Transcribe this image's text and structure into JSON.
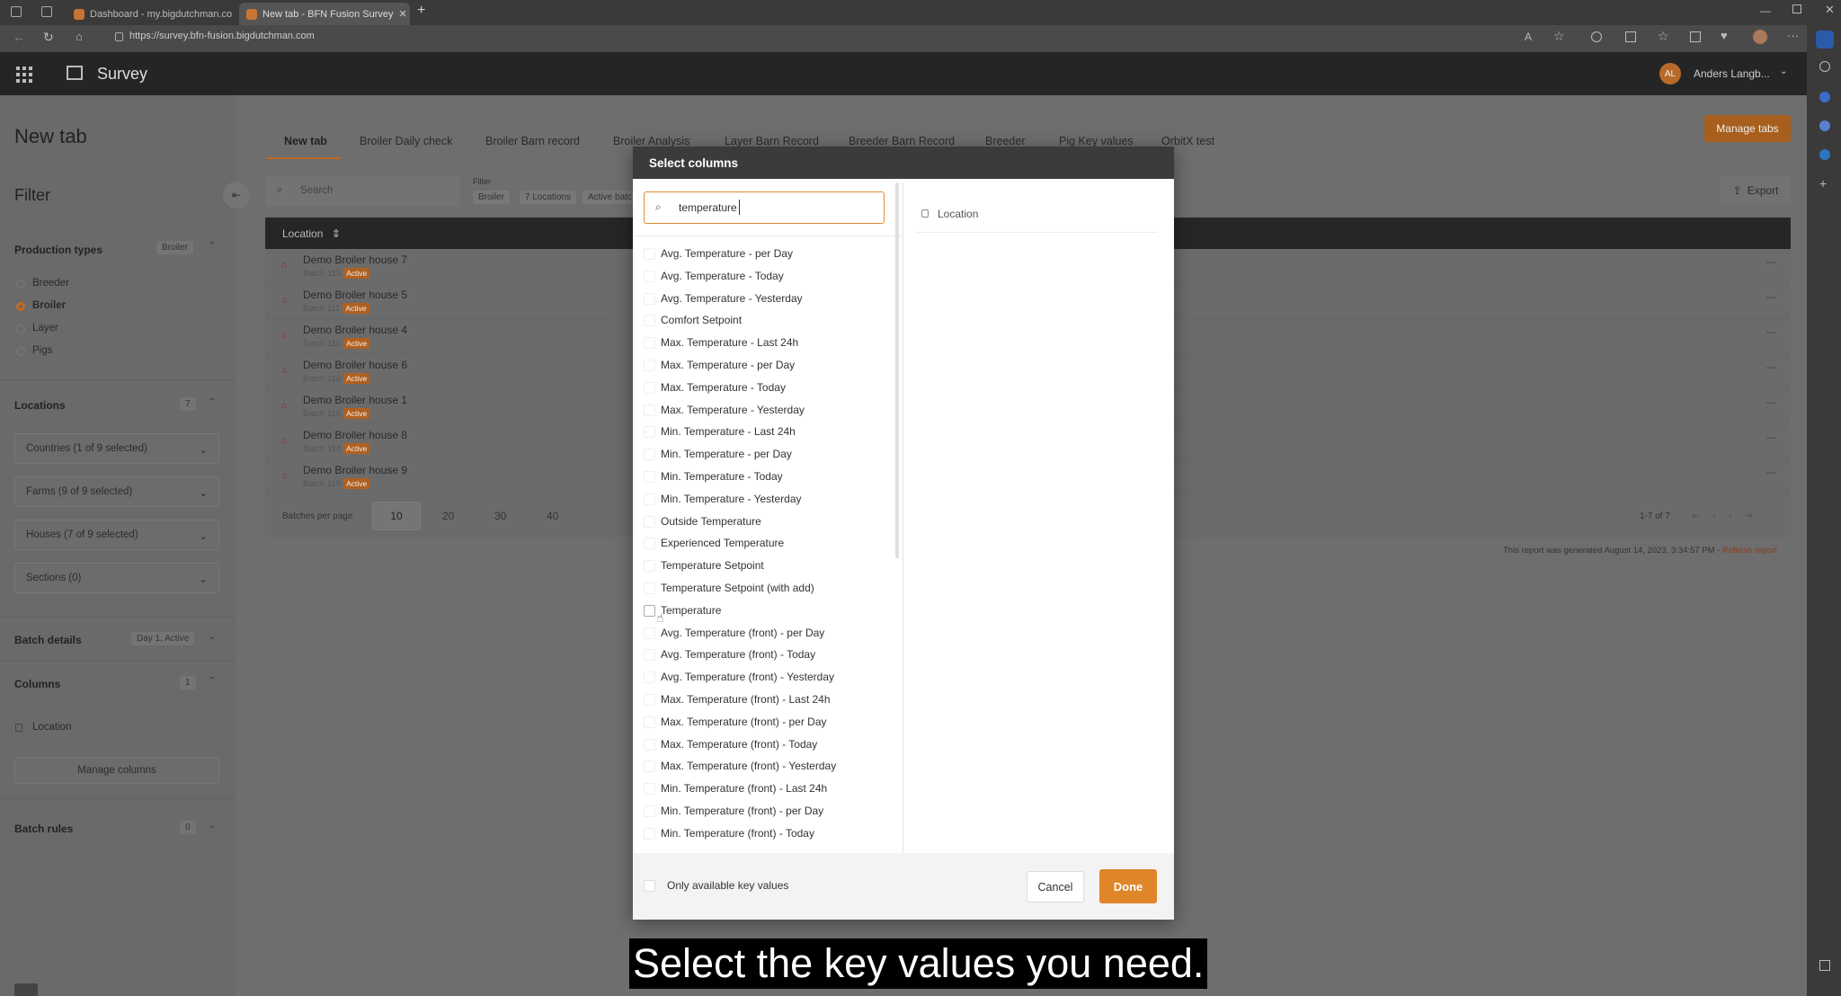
{
  "browser": {
    "tabs": [
      {
        "label": "Dashboard - my.bigdutchman.co",
        "active": false
      },
      {
        "label": "New tab - BFN Fusion Survey",
        "active": true
      }
    ],
    "new_tab_symbol": "+",
    "url": "https://survey.bfn-fusion.bigdutchman.com"
  },
  "appbar": {
    "title": "Survey",
    "user_initials": "AL",
    "user_name": "Anders Langb..."
  },
  "page": {
    "title": "New tab",
    "manage_tabs_label": "Manage tabs",
    "tabs": [
      "New tab",
      "Broiler Daily check",
      "Broiler Barn record",
      "Broiler Analysis",
      "Layer Barn Record",
      "Breeder Barn Record",
      "Breeder",
      "Pig Key values",
      "OrbitX test"
    ],
    "search_placeholder": "Search",
    "filter_label": "Filter",
    "filter_chips": [
      "Broiler",
      "7 Locations",
      "Active batc"
    ],
    "export_label": "Export",
    "report_note": "This report was generated August 14, 2023, 3:34:57 PM -",
    "refresh_label": "Refresh report"
  },
  "filter": {
    "title": "Filter",
    "production_types_label": "Production types",
    "production_types_badge": "Broiler",
    "production_options": [
      "Breeder",
      "Broiler",
      "Layer",
      "Pigs"
    ],
    "selected_production": "Broiler",
    "locations_label": "Locations",
    "locations_count": "7",
    "countries": "Countries (1 of 9 selected)",
    "farms": "Farms (9 of 9 selected)",
    "houses": "Houses (7 of 9 selected)",
    "sections": "Sections (0)",
    "batch_details_label": "Batch details",
    "batch_details_value": "Day 1, Active",
    "columns_label": "Columns",
    "columns_count": "1",
    "columns_location": "Location",
    "manage_columns": "Manage columns",
    "batch_rules_label": "Batch rules",
    "batch_rules_count": "0"
  },
  "table": {
    "header_location": "Location",
    "rows": [
      {
        "name": "Demo Broiler house 7",
        "batch": "Batch 113",
        "status": "Active"
      },
      {
        "name": "Demo Broiler house 5",
        "batch": "Batch 111",
        "status": "Active"
      },
      {
        "name": "Demo Broiler house 4",
        "batch": "Batch 110",
        "status": "Active"
      },
      {
        "name": "Demo Broiler house 6",
        "batch": "Batch 112",
        "status": "Active"
      },
      {
        "name": "Demo Broiler house 1",
        "batch": "Batch 116",
        "status": "Active"
      },
      {
        "name": "Demo Broiler house 8",
        "batch": "Batch 114",
        "status": "Active"
      },
      {
        "name": "Demo Broiler house 9",
        "batch": "Batch 115",
        "status": "Active"
      }
    ],
    "row_menu": "---",
    "batches_per_page_label": "Batches per page",
    "page_sizes": [
      "10",
      "20",
      "30",
      "40"
    ],
    "selected_page_size": "10",
    "pagination_text": "1-7 of 7"
  },
  "modal": {
    "title": "Select columns",
    "search_value": "temperature",
    "options": [
      "Avg. Temperature - per Day",
      "Avg. Temperature - Today",
      "Avg. Temperature - Yesterday",
      "Comfort Setpoint",
      "Max. Temperature - Last 24h",
      "Max. Temperature - per Day",
      "Max. Temperature - Today",
      "Max. Temperature - Yesterday",
      "Min. Temperature - Last 24h",
      "Min. Temperature - per Day",
      "Min. Temperature - Today",
      "Min. Temperature - Yesterday",
      "Outside Temperature",
      "Experienced Temperature",
      "Temperature Setpoint",
      "Temperature Setpoint (with add)",
      "Temperature",
      "Avg. Temperature (front) - per Day",
      "Avg. Temperature (front) - Today",
      "Avg. Temperature (front) - Yesterday",
      "Max. Temperature (front) - Last 24h",
      "Max. Temperature (front) - per Day",
      "Max. Temperature (front) - Today",
      "Max. Temperature (front) - Yesterday",
      "Min. Temperature (front) - Last 24h",
      "Min. Temperature (front) - per Day",
      "Min. Temperature (front) - Today"
    ],
    "selected_column": "Location",
    "only_available_label": "Only available key values",
    "cancel_label": "Cancel",
    "done_label": "Done"
  },
  "caption": "Select the key values you need.",
  "colors": {
    "accent": "#e0852a",
    "dark_bar": "#252525",
    "active_badge": "#b06020"
  }
}
